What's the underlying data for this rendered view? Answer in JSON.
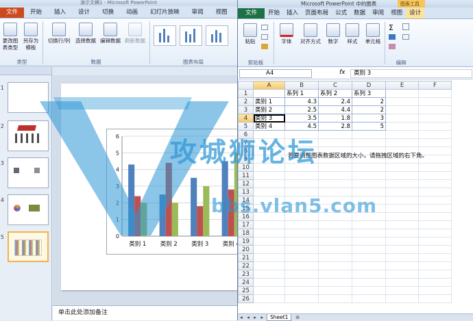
{
  "ppt": {
    "title": "演示文稿1 - Microsoft PowerPoint",
    "tabs": [
      "文件",
      "开始",
      "插入",
      "设计",
      "切换",
      "动画",
      "幻灯片放映",
      "审阅",
      "视图"
    ],
    "ribbon": {
      "type_group": {
        "label": "类型",
        "change_type": "更改图表类型",
        "save_template": "另存为模板"
      },
      "data_group": {
        "label": "数据",
        "switch_rowcol": "切换行/列",
        "select_data": "选择数据",
        "edit_data": "编辑数据",
        "refresh_data": "刷新数据"
      },
      "layout_group": {
        "label": "图表布局"
      }
    },
    "slides": [
      {
        "num": "1"
      },
      {
        "num": "2"
      },
      {
        "num": "3"
      },
      {
        "num": "4"
      },
      {
        "num": "5"
      }
    ],
    "notes_placeholder": "单击此处添加备注"
  },
  "chart_data": {
    "type": "bar",
    "categories": [
      "类别 1",
      "类别 2",
      "类别 3",
      "类别 4"
    ],
    "series": [
      {
        "name": "系列 1",
        "values": [
          4.3,
          2.5,
          3.5,
          4.5
        ],
        "color": "#4f81bd"
      },
      {
        "name": "系列 2",
        "values": [
          2.4,
          4.4,
          1.8,
          2.8
        ],
        "color": "#c0504d"
      },
      {
        "name": "系列 3",
        "values": [
          2,
          2,
          3,
          5
        ],
        "color": "#9bbb59"
      }
    ],
    "ylim": [
      0,
      6
    ],
    "yticks": [
      "0",
      "1",
      "2",
      "3",
      "4",
      "5",
      "6"
    ],
    "grid": true
  },
  "excel": {
    "title": "Microsoft PowerPoint 中的图表",
    "context_tab": "图表工具",
    "tabs": [
      "文件",
      "开始",
      "插入",
      "页面布局",
      "公式",
      "数据",
      "审阅",
      "视图",
      "设计"
    ],
    "ribbon": {
      "paste": "粘贴",
      "clipboard_label": "剪贴板",
      "font": "字体",
      "align": "对齐方式",
      "number": "数字",
      "style": "样式",
      "cells": "单元格",
      "editing_label": "编辑"
    },
    "namebox": "A4",
    "fx": "fx",
    "formula_value": "类别 3",
    "columns": [
      "A",
      "B",
      "C",
      "D",
      "E",
      "F"
    ],
    "rows": [
      [
        "",
        "系列 1",
        "系列 2",
        "系列 3",
        "",
        ""
      ],
      [
        "类别 1",
        "4.3",
        "2.4",
        "2",
        "",
        ""
      ],
      [
        "类别 2",
        "2.5",
        "4.4",
        "2",
        "",
        ""
      ],
      [
        "类别 3",
        "3.5",
        "1.8",
        "3",
        "",
        ""
      ],
      [
        "类别 4",
        "4.5",
        "2.8",
        "5",
        "",
        ""
      ]
    ],
    "row_numbers": [
      "1",
      "2",
      "3",
      "4",
      "5",
      "6",
      "7",
      "8",
      "9",
      "10",
      "11",
      "12",
      "13",
      "14",
      "15",
      "16",
      "17",
      "18",
      "19",
      "20",
      "21",
      "22",
      "23",
      "24",
      "25",
      "26"
    ],
    "overflow_note": "若要调整图表数据区域的大小，请拖拽区域的右下角。",
    "sheet_tab": "Sheet1"
  },
  "watermark": {
    "text": "攻城狮论坛",
    "url": "bbs.vlan5.com"
  }
}
